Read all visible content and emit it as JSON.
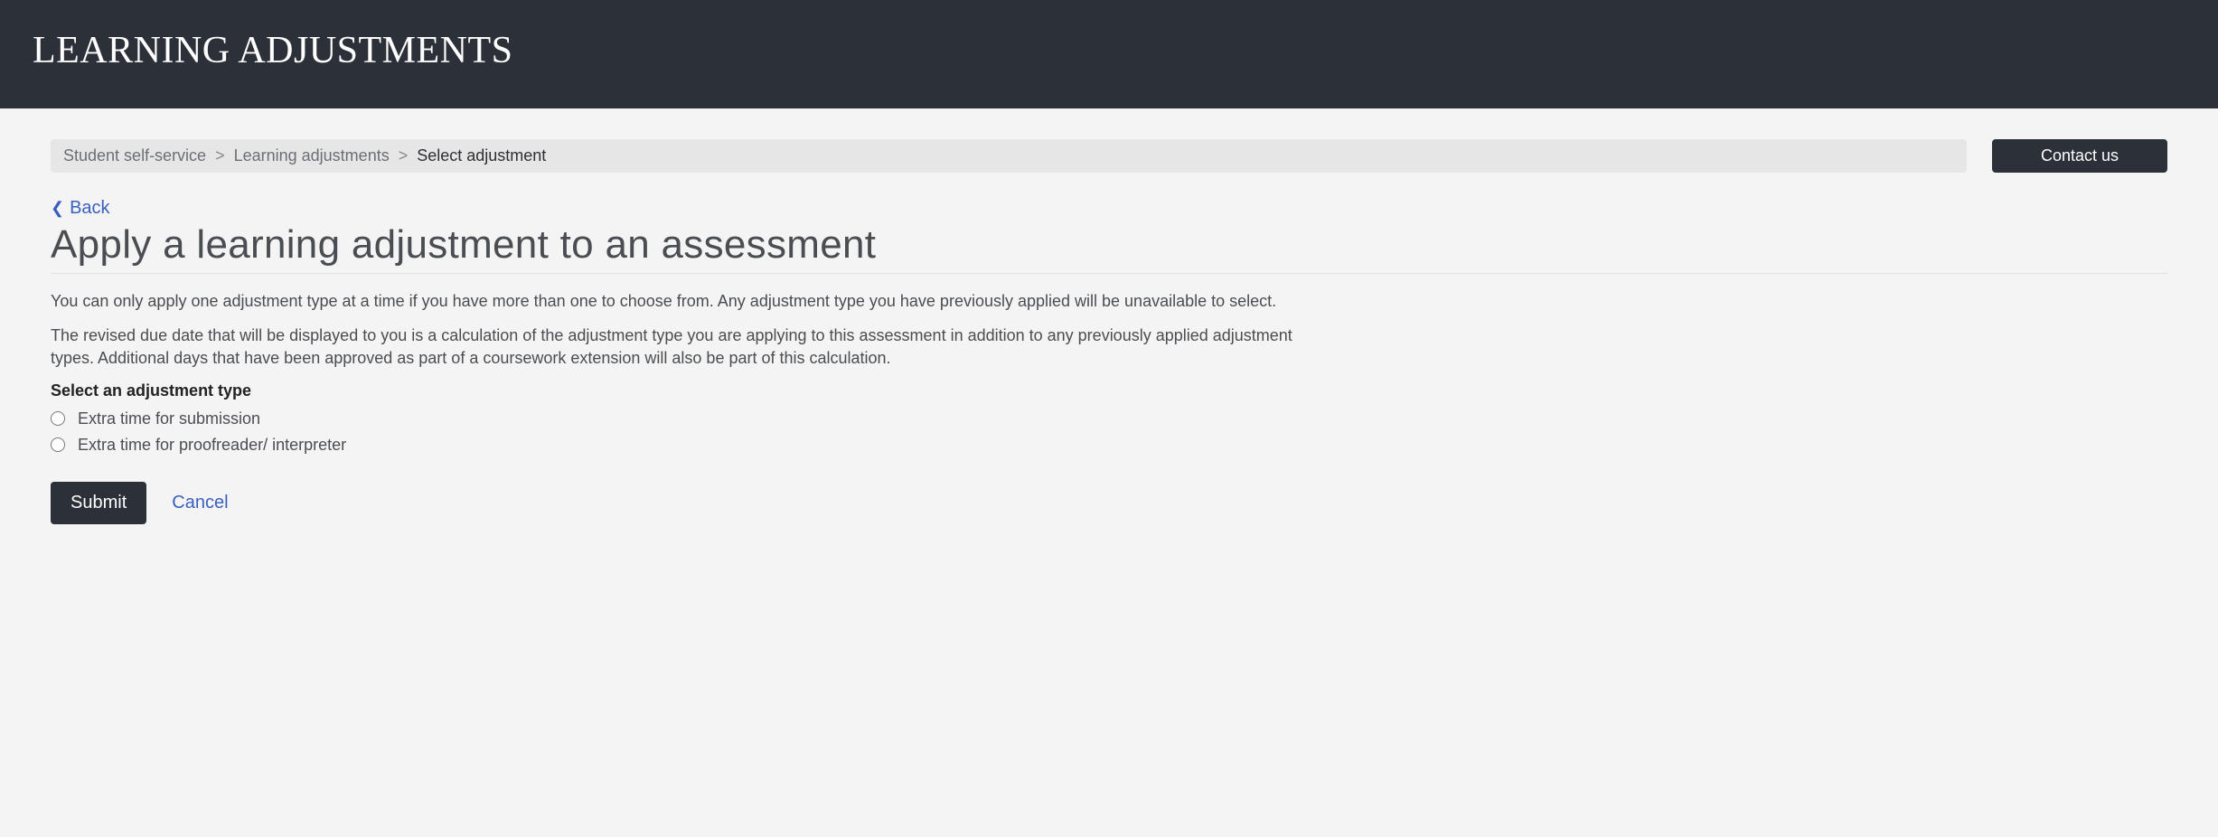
{
  "header": {
    "title": "LEARNING ADJUSTMENTS"
  },
  "breadcrumb": {
    "items": [
      "Student self-service",
      "Learning adjustments",
      "Select adjustment"
    ]
  },
  "contact_button": "Contact us",
  "back_link": "Back",
  "page_title": "Apply a learning adjustment to an assessment",
  "paragraphs": [
    "You can only apply one adjustment type at a time if you have more than one to choose from. Any adjustment type you have previously applied will be unavailable to select.",
    "The revised due date that will be displayed to you is a calculation of the adjustment type you are applying to this assessment in addition to any previously applied adjustment types. Additional days that have been approved as part of a coursework extension will also be part of this calculation."
  ],
  "select_label": "Select an adjustment type",
  "options": [
    "Extra time for submission",
    "Extra time for proofreader/ interpreter"
  ],
  "buttons": {
    "submit": "Submit",
    "cancel": "Cancel"
  }
}
